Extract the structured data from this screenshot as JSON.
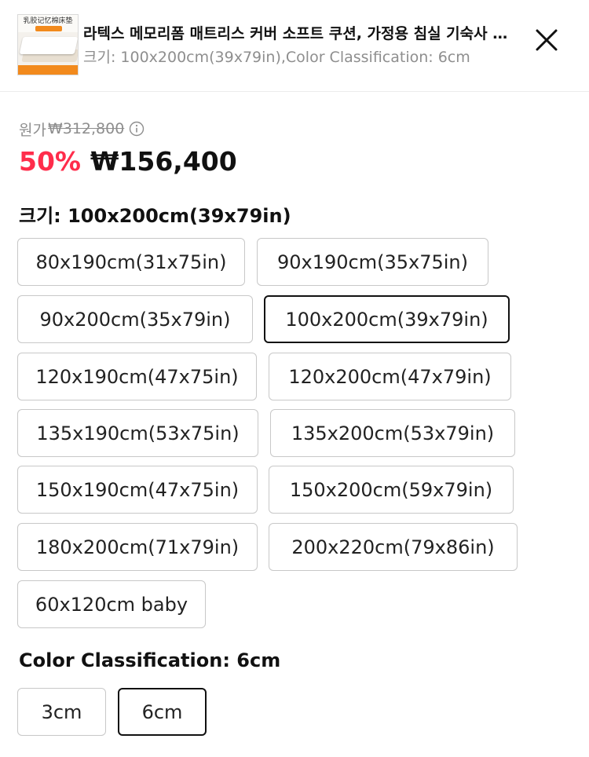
{
  "product": {
    "title": "라텍스 메모리폼 매트리스 커버 소프트 쿠션, 가정용 침실 기숙사 매트리스",
    "subtitle": "크기: 100x200cm(39x79in),Color Classification: 6cm",
    "thumbnail_text": "乳胶记忆棉床垫"
  },
  "price": {
    "original_label": "원가",
    "original_price": "₩312,800",
    "discount": "50%",
    "sale_price": "₩156,400"
  },
  "size_section": {
    "title": "크기: 100x200cm(39x79in)",
    "selected": "100x200cm(39x79in)",
    "options": [
      "80x190cm(31x75in)",
      "90x190cm(35x75in)",
      "90x200cm(35x79in)",
      "100x200cm(39x79in)",
      "120x190cm(47x75in)",
      "120x200cm(47x79in)",
      "135x190cm(53x75in)",
      "135x200cm(53x79in)",
      "150x190cm(47x75in)",
      "150x200cm(59x79in)",
      "180x200cm(71x79in)",
      "200x220cm(79x86in)",
      "60x120cm baby"
    ]
  },
  "color_section": {
    "title": "Color Classification: 6cm",
    "selected": "6cm",
    "options": [
      "3cm",
      "6cm"
    ]
  },
  "colors": {
    "discount": "#ff2d4b",
    "selected_border": "#111111",
    "option_border": "#c8c8c8"
  },
  "icons": {
    "close": "close-icon",
    "info": "info-icon"
  }
}
